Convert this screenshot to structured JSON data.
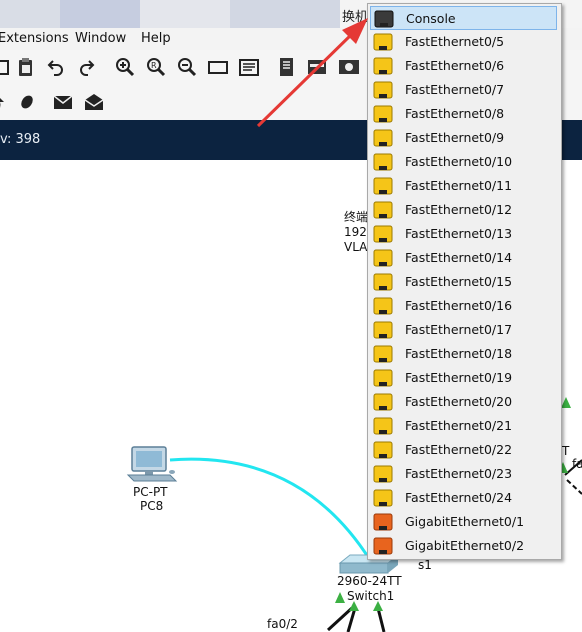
{
  "window": {
    "title_partial": "换机"
  },
  "menu": {
    "extensions": "Extensions",
    "window": "Window",
    "help": "Help"
  },
  "status": {
    "text": "v: 398"
  },
  "canvas": {
    "pc": {
      "type_label": "PC-PT",
      "name_label": "PC8"
    },
    "device_info": {
      "line1": "终端",
      "line2": "192",
      "line3": "VLA"
    },
    "switch": {
      "model_label": "2960-24TT",
      "name_label": "Switch1",
      "tag": "s1"
    },
    "port_label": "fa0/2",
    "right_port_label": "fa",
    "right_mark": "T"
  },
  "port_menu": {
    "items": [
      {
        "label": "Console",
        "kind": "console"
      },
      {
        "label": "FastEthernet0/5",
        "kind": "fast"
      },
      {
        "label": "FastEthernet0/6",
        "kind": "fast"
      },
      {
        "label": "FastEthernet0/7",
        "kind": "fast"
      },
      {
        "label": "FastEthernet0/8",
        "kind": "fast"
      },
      {
        "label": "FastEthernet0/9",
        "kind": "fast"
      },
      {
        "label": "FastEthernet0/10",
        "kind": "fast"
      },
      {
        "label": "FastEthernet0/11",
        "kind": "fast"
      },
      {
        "label": "FastEthernet0/12",
        "kind": "fast"
      },
      {
        "label": "FastEthernet0/13",
        "kind": "fast"
      },
      {
        "label": "FastEthernet0/14",
        "kind": "fast"
      },
      {
        "label": "FastEthernet0/15",
        "kind": "fast"
      },
      {
        "label": "FastEthernet0/16",
        "kind": "fast"
      },
      {
        "label": "FastEthernet0/17",
        "kind": "fast"
      },
      {
        "label": "FastEthernet0/18",
        "kind": "fast"
      },
      {
        "label": "FastEthernet0/19",
        "kind": "fast"
      },
      {
        "label": "FastEthernet0/20",
        "kind": "fast"
      },
      {
        "label": "FastEthernet0/21",
        "kind": "fast"
      },
      {
        "label": "FastEthernet0/22",
        "kind": "fast"
      },
      {
        "label": "FastEthernet0/23",
        "kind": "fast"
      },
      {
        "label": "FastEthernet0/24",
        "kind": "fast"
      },
      {
        "label": "GigabitEthernet0/1",
        "kind": "gigabit"
      },
      {
        "label": "GigabitEthernet0/2",
        "kind": "gigabit"
      }
    ],
    "selected_index": 0
  },
  "colors": {
    "status_bar": "#0c2340",
    "fast_port": "#f5c518",
    "gigabit_port": "#e8641e",
    "console_port": "#3a3a3a",
    "link_cyan": "#22e6f0",
    "link_up": "#3cb043",
    "annotation_arrow": "#e53935",
    "selection": "#cce4f7"
  },
  "toolbar_icons": [
    "open-file-icon",
    "paste-icon",
    "undo-icon",
    "redo-icon",
    "zoom-in-icon",
    "zoom-reset-icon",
    "zoom-out-icon",
    "rectangle-icon",
    "palette-icon",
    "notes-icon",
    "device-list-icon",
    "cluster-icon"
  ],
  "toolbar2_icons": [
    "pointer-icon",
    "ellipse-icon",
    "simple-pdu-icon",
    "complex-pdu-icon"
  ]
}
